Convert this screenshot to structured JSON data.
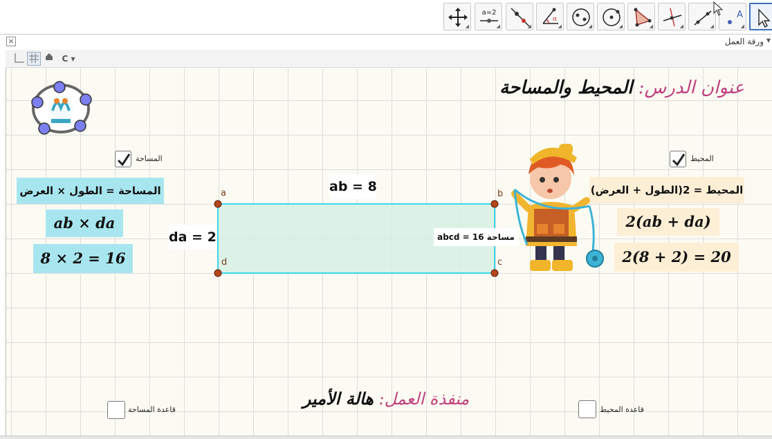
{
  "toolbar": {
    "tools": [
      {
        "name": "move-graphics-tool",
        "label": "",
        "icon": "move-arrows-icon"
      },
      {
        "name": "slider-tool",
        "label": "a=2",
        "icon": "slider-icon"
      },
      {
        "name": "line-tool",
        "label": "",
        "icon": "line-icon"
      },
      {
        "name": "angle-tool",
        "label": "α",
        "icon": "angle-icon"
      },
      {
        "name": "ellipse-tool",
        "label": "",
        "icon": "ellipse-icon"
      },
      {
        "name": "circle-tool",
        "label": "",
        "icon": "circle-icon"
      },
      {
        "name": "polygon-tool",
        "label": "",
        "icon": "polygon-icon"
      },
      {
        "name": "perpendicular-line-tool",
        "label": "",
        "icon": "perpendicular-icon"
      },
      {
        "name": "segment-tool",
        "label": "",
        "icon": "segment-icon"
      },
      {
        "name": "point-tool",
        "label": "A",
        "icon": "point-icon"
      },
      {
        "name": "select-tool",
        "label": "",
        "icon": "cursor-icon"
      }
    ]
  },
  "view": {
    "title": "ورقة العمل"
  },
  "lesson": {
    "title_prefix": "عنوان الدرس:",
    "title_main": "المحيط والمساحة"
  },
  "worker": {
    "prefix": "منفذة العمل:",
    "name": "هالة الأمير"
  },
  "checkboxes": {
    "area": {
      "label": "المساحة",
      "checked": true
    },
    "perimeter": {
      "label": "المحيط",
      "checked": true
    },
    "area_rule": {
      "label": "قاعدة المساحة",
      "checked": false
    },
    "perimeter_rule": {
      "label": "قاعدة المحيط",
      "checked": false
    }
  },
  "area": {
    "rule": "المساحة = الطول × العرض",
    "formula": "ab × da",
    "computation": "8 × 2 = 16"
  },
  "perimeter": {
    "rule": "المحيط = 2(الطول + العرض)",
    "formula": "2(ab + da)",
    "computation": "2(8 + 2) = 20"
  },
  "rectangle": {
    "points": {
      "a": "a",
      "b": "b",
      "c": "c",
      "d": "d"
    },
    "ab_label": "ab = 8",
    "da_label": "da = 2",
    "area_label": "abcd = 16  مساحة"
  },
  "colors": {
    "accent_pink": "#c0417e",
    "cyan_box": "#a8e6ef",
    "peach_box": "#fdefd6",
    "rect_fill": "#d6f0e4",
    "rect_stroke": "#3fd6ea",
    "point_fill": "#b5461c",
    "logo_point": "#7b7ff0"
  }
}
